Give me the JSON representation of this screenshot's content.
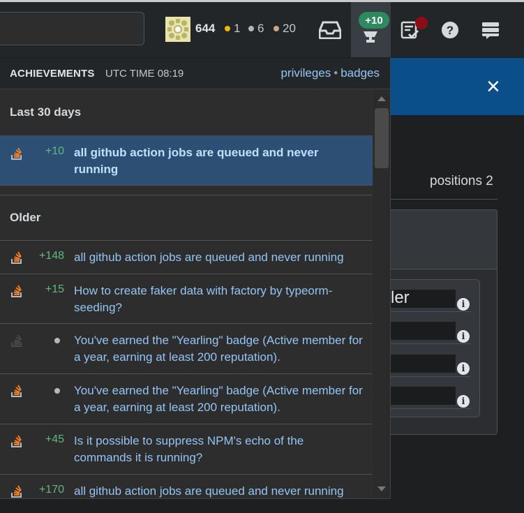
{
  "topbar": {
    "reputation": "644",
    "gold": "1",
    "silver": "6",
    "bronze": "20",
    "achievement_count": "+10",
    "icons": [
      "inbox-icon",
      "trophy-icon",
      "review-icon",
      "help-icon",
      "site-switcher-icon"
    ],
    "colors": {
      "gold": "#f1b600",
      "silver": "#b4b8bc",
      "bronze": "#d1a684",
      "accent_green": "#2d8a5e"
    }
  },
  "background_page": {
    "close": "×",
    "positions_label": "positions 2",
    "field_fragment": "ler"
  },
  "achievements": {
    "title": "ACHIEVEMENTS",
    "time": "UTC TIME 08:19",
    "link_privileges": "privileges",
    "link_separator": "•",
    "link_badges": "badges",
    "section_recent": "Last 30 days",
    "section_older": "Older",
    "recent": [
      {
        "amount": "+10",
        "text": "all github action jobs are queued and never running"
      }
    ],
    "older": [
      {
        "amount": "+148",
        "text": "all github action jobs are queued and never running",
        "type": "rep"
      },
      {
        "amount": "+15",
        "text": "How to create faker data with factory by typeorm-seeding?",
        "type": "rep"
      },
      {
        "amount": "",
        "text": "You've earned the \"Yearling\" badge (Active member for a year, earning at least 200 reputation).",
        "type": "badge",
        "icon_dim": true
      },
      {
        "amount": "",
        "text": "You've earned the \"Yearling\" badge (Active member for a year, earning at least 200 reputation).",
        "type": "badge"
      },
      {
        "amount": "+45",
        "text": "Is it possible to suppress NPM's echo of the commands it is running?",
        "type": "rep"
      },
      {
        "amount": "+170",
        "text": "all github action jobs are queued and never running",
        "type": "rep"
      }
    ]
  }
}
